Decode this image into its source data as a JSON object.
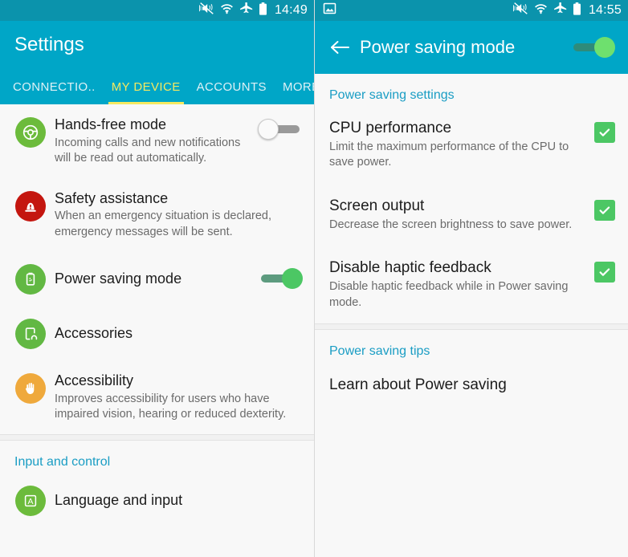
{
  "left": {
    "statusbar": {
      "time": "14:49",
      "icons": [
        "mute-vibrate-off-icon",
        "wifi-icon",
        "airplane-mode-icon",
        "battery-icon"
      ]
    },
    "appbar": {
      "title": "Settings"
    },
    "tabs": [
      {
        "label": "CONNECTIO..",
        "active": false
      },
      {
        "label": "MY DEVICE",
        "active": true
      },
      {
        "label": "ACCOUNTS",
        "active": false
      },
      {
        "label": "MORE",
        "active": false
      }
    ],
    "items": [
      {
        "title": "Hands-free mode",
        "subtitle": "Incoming calls and new notifications will be read out automatically.",
        "icon": "steering-wheel-icon",
        "toggle": "off"
      },
      {
        "title": "Safety assistance",
        "subtitle": "When an emergency situation is declared, emergency messages will be sent.",
        "icon": "alert-siren-icon",
        "toggle": "none"
      },
      {
        "title": "Power saving mode",
        "subtitle": "",
        "icon": "battery-recycle-icon",
        "toggle": "on"
      },
      {
        "title": "Accessories",
        "subtitle": "",
        "icon": "dock-headphone-icon",
        "toggle": "none"
      },
      {
        "title": "Accessibility",
        "subtitle": "Improves accessibility for users who have impaired vision, hearing or reduced dexterity.",
        "icon": "hand-icon",
        "toggle": "none"
      }
    ],
    "section2": {
      "header": "Input and control",
      "items": [
        {
          "title": "Language and input",
          "icon": "letter-a-icon"
        }
      ]
    }
  },
  "right": {
    "statusbar": {
      "time": "14:55",
      "left_icon": "screenshot-image-icon",
      "icons": [
        "mute-vibrate-off-icon",
        "wifi-icon",
        "airplane-mode-icon",
        "battery-icon"
      ]
    },
    "appbar": {
      "back": "back-arrow-icon",
      "title": "Power saving mode",
      "toggle": "on"
    },
    "settings_header": "Power saving settings",
    "settings": [
      {
        "title": "CPU performance",
        "subtitle": "Limit the maximum performance of the CPU to save power.",
        "checked": true
      },
      {
        "title": "Screen output",
        "subtitle": "Decrease the screen brightness to save power.",
        "checked": true
      },
      {
        "title": "Disable haptic feedback",
        "subtitle": "Disable haptic feedback while in Power saving mode.",
        "checked": true
      }
    ],
    "tips_header": "Power saving tips",
    "tips": [
      {
        "label": "Learn about Power saving"
      }
    ]
  },
  "colors": {
    "teal": "#00a6c7",
    "teal_dark": "#0b93ac",
    "accent_yellow": "#f5e960",
    "link_blue": "#1a9dc4",
    "green": "#4cc764"
  }
}
